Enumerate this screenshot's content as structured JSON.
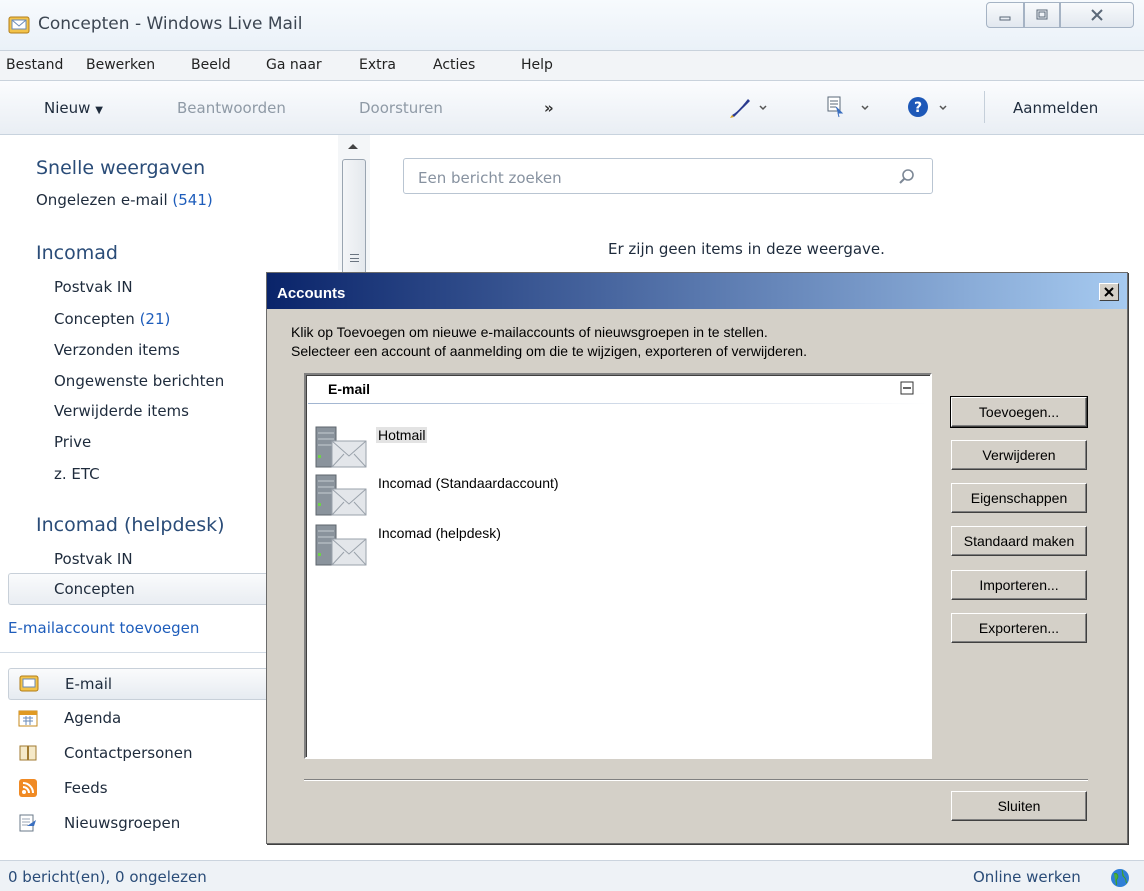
{
  "window": {
    "title": "Concepten - Windows Live Mail"
  },
  "menu": [
    "Bestand",
    "Bewerken",
    "Beeld",
    "Ga naar",
    "Extra",
    "Acties",
    "Help"
  ],
  "toolbar": {
    "new": "Nieuw",
    "reply": "Beantwoorden",
    "forward": "Doorsturen",
    "more": "»",
    "signin": "Aanmelden"
  },
  "sidebar": {
    "quick_views": {
      "title": "Snelle weergaven",
      "unread_label": "Ongelezen e-mail",
      "unread_count": "(541)"
    },
    "account1": {
      "title": "Incomad",
      "folders": [
        {
          "label": "Postvak IN",
          "count": ""
        },
        {
          "label": "Concepten",
          "count": "(21)"
        },
        {
          "label": "Verzonden items",
          "count": ""
        },
        {
          "label": "Ongewenste berichten",
          "count": ""
        },
        {
          "label": "Verwijderde items",
          "count": ""
        },
        {
          "label": "Prive",
          "count": ""
        },
        {
          "label": "z. ETC",
          "count": ""
        }
      ]
    },
    "account2": {
      "title": "Incomad (helpdesk)",
      "folders": [
        {
          "label": "Postvak IN"
        },
        {
          "label": "Concepten"
        }
      ]
    },
    "add_account": "E-mailaccount toevoegen",
    "nav": [
      {
        "label": "E-mail",
        "icon": "mail-icon"
      },
      {
        "label": "Agenda",
        "icon": "calendar-icon"
      },
      {
        "label": "Contactpersonen",
        "icon": "contacts-icon"
      },
      {
        "label": "Feeds",
        "icon": "rss-icon"
      },
      {
        "label": "Nieuwsgroepen",
        "icon": "newsgroups-icon"
      }
    ]
  },
  "main": {
    "search_placeholder": "Een bericht zoeken",
    "empty_message": "Er zijn geen items in deze weergave."
  },
  "status": {
    "left": "0 bericht(en), 0 ongelezen",
    "right": "Online werken"
  },
  "dialog": {
    "title": "Accounts",
    "instruction1": "Klik op Toevoegen om nieuwe e-mailaccounts of nieuwsgroepen in te stellen.",
    "instruction2": "Selecteer een account of aanmelding om die te wijzigen, exporteren of verwijderen.",
    "group": "E-mail",
    "accounts": [
      "Hotmail",
      "Incomad (Standaardaccount)",
      "Incomad (helpdesk)"
    ],
    "buttons": {
      "add": "Toevoegen...",
      "remove": "Verwijderen",
      "properties": "Eigenschappen",
      "set_default": "Standaard maken",
      "import": "Importeren...",
      "export": "Exporteren...",
      "close": "Sluiten"
    }
  }
}
